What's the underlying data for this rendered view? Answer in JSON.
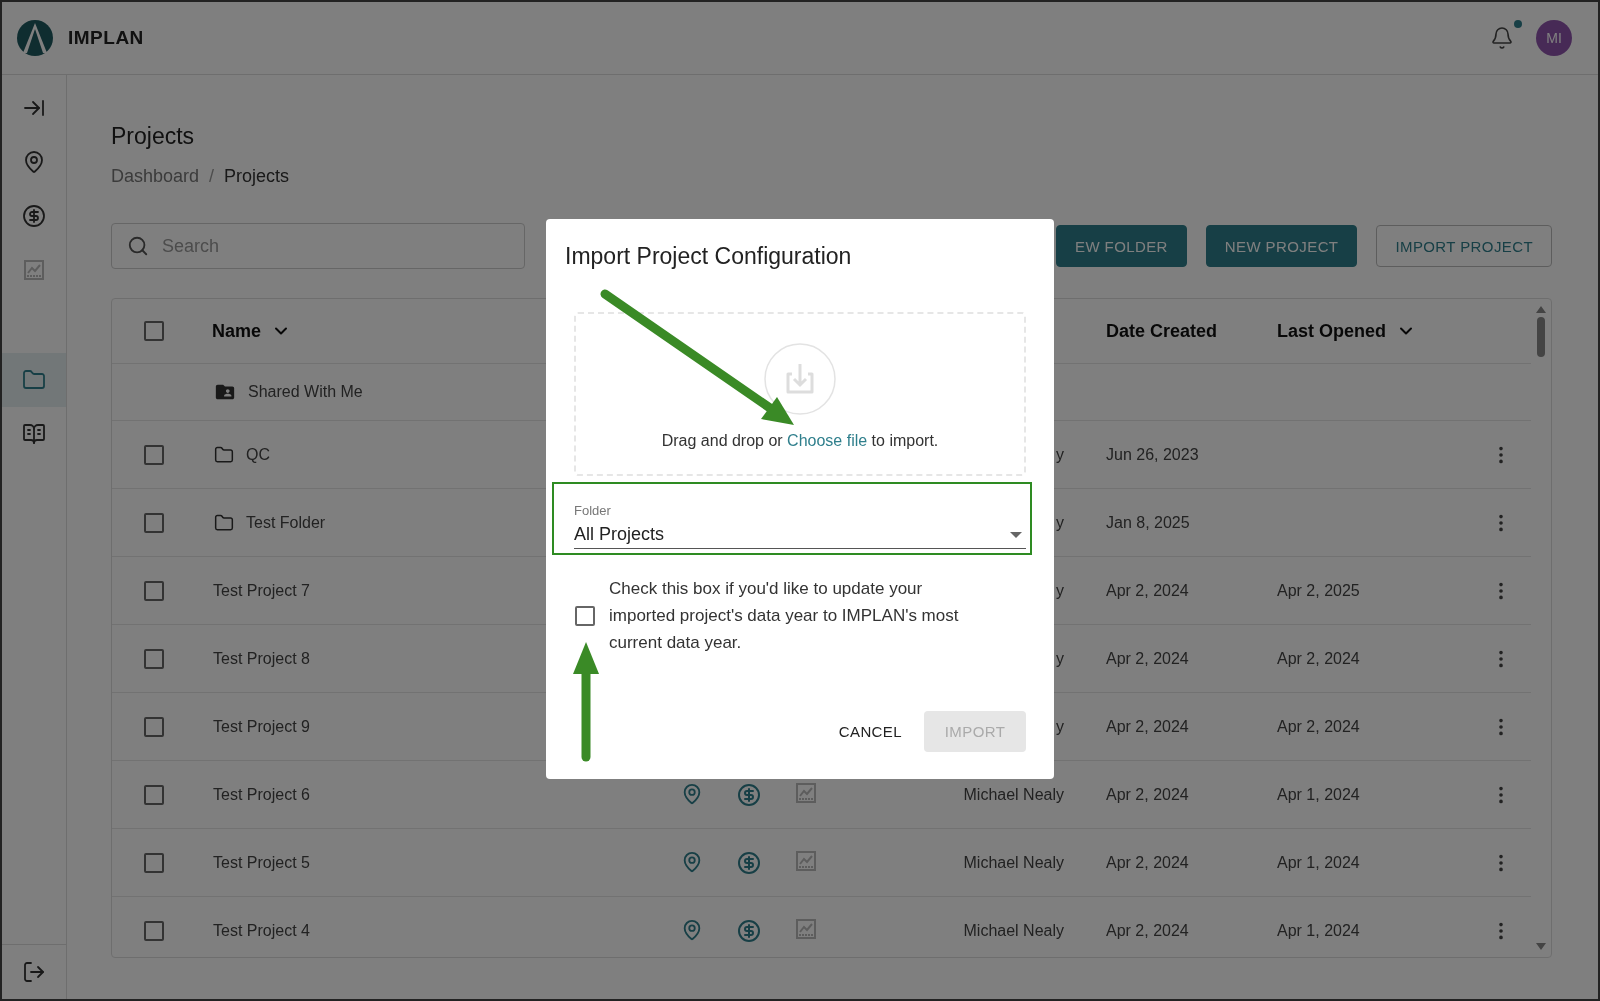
{
  "app": {
    "brand": "IMPLAN",
    "avatar": "MI",
    "notifications_unread": true
  },
  "sidebar": {
    "items": [
      {
        "kind": "expand",
        "selected": false,
        "disabled": false
      },
      {
        "kind": "region",
        "selected": false,
        "disabled": false
      },
      {
        "kind": "dollar",
        "selected": false,
        "disabled": false
      },
      {
        "kind": "chart",
        "selected": false,
        "disabled": true
      },
      {
        "kind": "folder",
        "selected": true,
        "disabled": false
      },
      {
        "kind": "book",
        "selected": false,
        "disabled": false
      }
    ],
    "bottom_items": [
      {
        "kind": "logout",
        "selected": false,
        "disabled": false
      }
    ]
  },
  "page": {
    "title": "Projects",
    "breadcrumb_separator": "/",
    "breadcrumb": [
      {
        "label": "Dashboard",
        "current": false
      },
      {
        "label": "Projects",
        "current": true
      }
    ],
    "search": {
      "placeholder": "Search"
    },
    "actions": [
      {
        "label": "EW FOLDER",
        "kind": "primary"
      },
      {
        "label": "NEW PROJECT",
        "kind": "primary"
      },
      {
        "label": "IMPORT PROJECT",
        "kind": "outlined"
      }
    ]
  },
  "table": {
    "header_checked": false,
    "columns": [
      {
        "label": "Name",
        "sortable": true
      },
      {
        "label": "Date Created",
        "sortable": false
      },
      {
        "label": "Last Opened",
        "sortable": true
      }
    ],
    "rows": [
      {
        "kind": "shared",
        "name": "Shared With Me"
      },
      {
        "kind": "folder",
        "checked": false,
        "name": "QC",
        "owner": "y",
        "date_created": "Jun 26, 2023"
      },
      {
        "kind": "folder",
        "checked": false,
        "name": "Test Folder",
        "owner": "y",
        "date_created": "Jan 8, 2025"
      },
      {
        "kind": "project",
        "checked": false,
        "name": "Test Project 7",
        "owner": "y",
        "date_created": "Apr 2, 2024",
        "last_opened": "Apr 2, 2025"
      },
      {
        "kind": "project",
        "checked": false,
        "name": "Test Project 8",
        "owner": "y",
        "date_created": "Apr 2, 2024",
        "last_opened": "Apr 2, 2024"
      },
      {
        "kind": "project",
        "checked": false,
        "name": "Test Project 9",
        "owner": "y",
        "date_created": "Apr 2, 2024",
        "last_opened": "Apr 2, 2024"
      },
      {
        "kind": "project",
        "checked": false,
        "name": "Test Project 6",
        "icons": [
          {
            "kind": "region",
            "disabled": false
          },
          {
            "kind": "dollar",
            "disabled": false
          },
          {
            "kind": "chart",
            "disabled": true
          }
        ],
        "owner": "Michael Nealy",
        "date_created": "Apr 2, 2024",
        "last_opened": "Apr 1, 2024"
      },
      {
        "kind": "project",
        "checked": false,
        "name": "Test Project 5",
        "icons": [
          {
            "kind": "region",
            "disabled": false
          },
          {
            "kind": "dollar",
            "disabled": false
          },
          {
            "kind": "chart",
            "disabled": true
          }
        ],
        "owner": "Michael Nealy",
        "date_created": "Apr 2, 2024",
        "last_opened": "Apr 1, 2024"
      },
      {
        "kind": "project",
        "checked": false,
        "name": "Test Project 4",
        "icons": [
          {
            "kind": "region",
            "disabled": false
          },
          {
            "kind": "dollar",
            "disabled": false
          },
          {
            "kind": "chart",
            "disabled": true
          }
        ],
        "owner": "Michael Nealy",
        "date_created": "Apr 2, 2024",
        "last_opened": "Apr 1, 2024"
      }
    ]
  },
  "dialog": {
    "title": "Import Project Configuration",
    "dropzone": {
      "text_before": "Drag and drop or ",
      "link": "Choose file",
      "text_after": " to import."
    },
    "folder": {
      "label": "Folder",
      "value": "All Projects"
    },
    "update_data_year": {
      "checked": false,
      "label": "Check this box if you'd like to update your imported project's data year to IMPLAN's most current data year."
    },
    "buttons": [
      {
        "label": "CANCEL",
        "kind": "text",
        "disabled": false
      },
      {
        "label": "IMPORT",
        "kind": "contained",
        "disabled": true
      }
    ]
  }
}
